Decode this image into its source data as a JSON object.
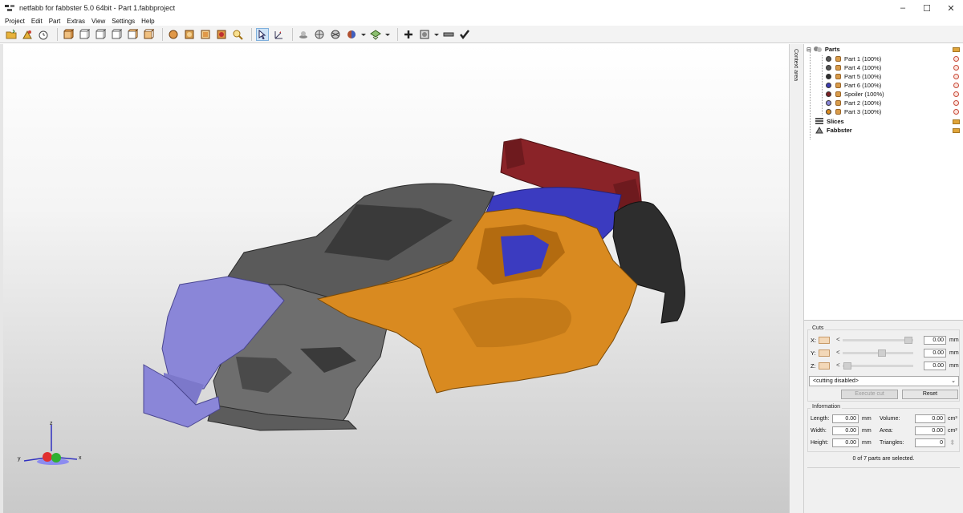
{
  "window": {
    "title": "netfabb for fabbster 5.0 64bit - Part 1.fabbproject",
    "minimize": "–",
    "maximize": "☐",
    "close": "✕"
  },
  "menu": [
    "Project",
    "Edit",
    "Part",
    "Extras",
    "View",
    "Settings",
    "Help"
  ],
  "sidebar_tab_label": "Context area",
  "tree": {
    "root": "Parts",
    "items": [
      {
        "label": "Part 1 (100%)",
        "color": "#555555"
      },
      {
        "label": "Part 4 (100%)",
        "color": "#555555"
      },
      {
        "label": "Part 5 (100%)",
        "color": "#3a3a3a"
      },
      {
        "label": "Part 6 (100%)",
        "color": "#3b3bb0"
      },
      {
        "label": "Spoiler (100%)",
        "color": "#7a1f22"
      },
      {
        "label": "Part 2 (100%)",
        "color": "#8a86d8"
      },
      {
        "label": "Part 3 (100%)",
        "color": "#d98a20"
      }
    ],
    "slices": "Slices",
    "fabbster": "Fabbster"
  },
  "cuts": {
    "title": "Cuts",
    "x_label": "X:",
    "y_label": "Y:",
    "z_label": "Z:",
    "x_value": "0.00",
    "y_value": "0.00",
    "z_value": "0.00",
    "unit": "mm",
    "mode": "<cutting disabled>",
    "execute": "Execute cut",
    "reset": "Reset"
  },
  "information": {
    "title": "Information",
    "length_label": "Length:",
    "width_label": "Width:",
    "height_label": "Height:",
    "length": "0.00",
    "width": "0.00",
    "height": "0.00",
    "mm": "mm",
    "volume_label": "Volume:",
    "area_label": "Area:",
    "triangles_label": "Triangles:",
    "volume": "0.00",
    "area": "0.00",
    "triangles": "0",
    "cm3": "cm³",
    "cm2": "cm²"
  },
  "status": "0 of 7 parts are selected.",
  "axes": {
    "x": "x",
    "y": "y",
    "z": "z"
  },
  "colors": {
    "orange": "#d98a20",
    "gray": "#5a5a5a",
    "dark": "#2d2d2d",
    "lavender": "#8a86d8",
    "blue": "#3b3bc0",
    "spoiler": "#8a2328"
  }
}
